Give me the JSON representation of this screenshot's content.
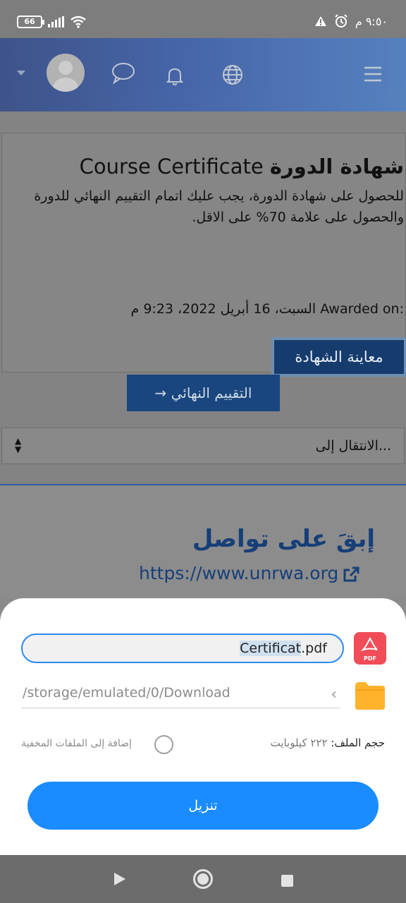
{
  "status_bar": {
    "battery": "66",
    "time": "٩:٥٠ م",
    "icons": [
      "battery-icon",
      "signal-icon",
      "wifi-icon",
      "warning-icon",
      "alarm-icon"
    ]
  },
  "header": {
    "icons": [
      "dropdown-caret-icon",
      "avatar",
      "chat-icon",
      "bell-icon",
      "globe-icon",
      "menu-icon"
    ]
  },
  "course": {
    "title_en": "Course Certificate",
    "title_ar": "شهادة الدورة",
    "description": "للحصول على شهادة الدورة، يجب عليك اتمام التقييم النهائي للدورة والحصول على علامة 70% على الاقل.",
    "awarded_label": "Awarded on:",
    "awarded_date": "السبت، 16 أبريل 2022، 9:23 م",
    "preview_button": "معاينة الشهادة",
    "final_button": "→ التقييم النهائي",
    "jump_label": "الانتقال إلى..."
  },
  "footer": {
    "stay_in_touch": "إبقَ على تواصل",
    "link": "https://www.unrwa.org"
  },
  "download_sheet": {
    "filename_selected": "Certificat",
    "filename_ext": ".pdf",
    "path": "/storage/emulated/0/Download",
    "size_label": "حجم الملف:",
    "size_value": "٢٢٢ كيلوبايت",
    "hidden_label": "إضافة إلى الملفات المخفية",
    "download_button": "تنزيل",
    "pdf_badge": "PDF"
  },
  "colors": {
    "accent": "#1a8cff",
    "header_blue": "#2a56b5",
    "pdf_red": "#f04d58",
    "folder_yellow": "#ffb22c"
  }
}
